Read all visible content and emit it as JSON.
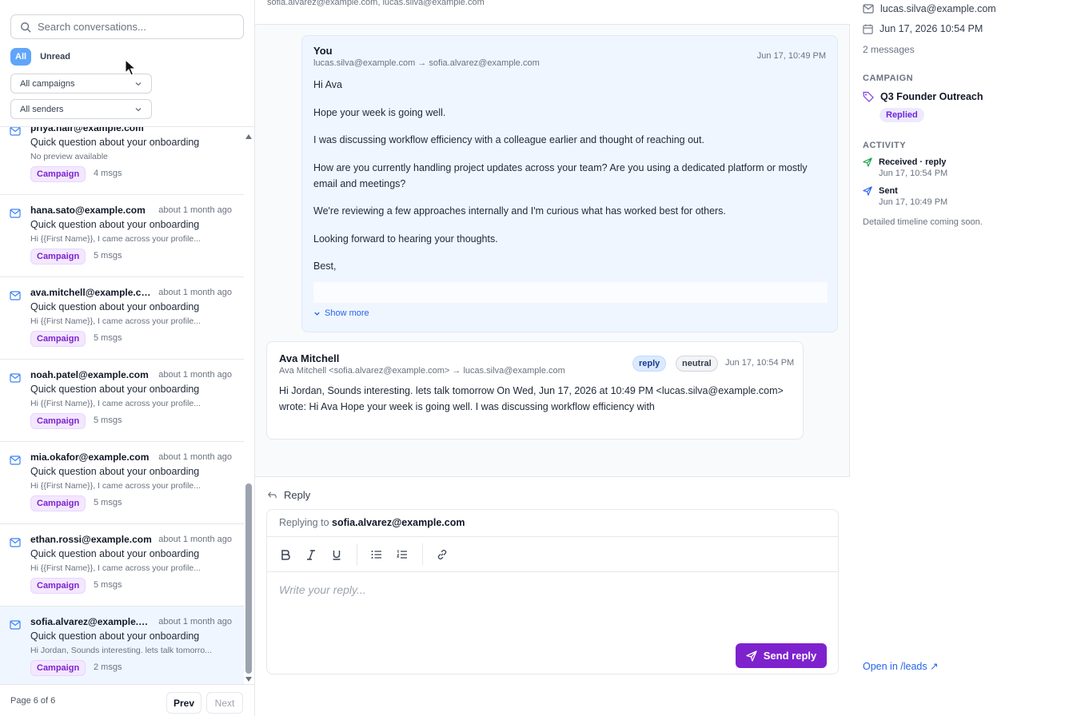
{
  "sidebar": {
    "search_placeholder": "Search conversations...",
    "filter_all": "All",
    "filter_unread": "Unread",
    "campaign_select": "All campaigns",
    "sender_select": "All senders",
    "items": [
      {
        "email": "priya.nair@example.com",
        "time": "",
        "subject": "Quick question about your onboarding",
        "preview": "No preview available",
        "badge": "Campaign",
        "msgs": "4 msgs"
      },
      {
        "email": "hana.sato@example.com",
        "time": "about 1 month ago",
        "subject": "Quick question about your onboarding",
        "preview": "Hi {{First Name}}, I came across your profile...",
        "badge": "Campaign",
        "msgs": "5 msgs"
      },
      {
        "email": "ava.mitchell@example.com",
        "time": "about 1 month ago",
        "subject": "Quick question about your onboarding",
        "preview": "Hi {{First Name}}, I came across your profile...",
        "badge": "Campaign",
        "msgs": "5 msgs"
      },
      {
        "email": "noah.patel@example.com",
        "time": "about 1 month ago",
        "subject": "Quick question about your onboarding",
        "preview": "Hi {{First Name}}, I came across your profile...",
        "badge": "Campaign",
        "msgs": "5 msgs"
      },
      {
        "email": "mia.okafor@example.com",
        "time": "about 1 month ago",
        "subject": "Quick question about your onboarding",
        "preview": "Hi {{First Name}}, I came across your profile...",
        "badge": "Campaign",
        "msgs": "5 msgs"
      },
      {
        "email": "ethan.rossi@example.com",
        "time": "about 1 month ago",
        "subject": "Quick question about your onboarding",
        "preview": "Hi {{First Name}}, I came across your profile...",
        "badge": "Campaign",
        "msgs": "5 msgs"
      },
      {
        "email": "sofia.alvarez@example.com",
        "time": "about 1 month ago",
        "subject": "Quick question about your onboarding",
        "preview": "Hi Jordan, Sounds interesting. lets talk tomorro...",
        "badge": "Campaign",
        "msgs": "2 msgs"
      }
    ],
    "pager": {
      "info": "Page 6 of 6",
      "prev": "Prev",
      "next": "Next"
    }
  },
  "thread": {
    "top_recipients": "sofia.alvarez@example.com, lucas.silva@example.com",
    "message1": {
      "from": "You",
      "route": "lucas.silva@example.com → sofia.alvarez@example.com",
      "time": "Jun 17, 10:49 PM",
      "paragraphs": [
        "Hi Ava",
        "Hope your week is going well.",
        "I was discussing workflow efficiency with a colleague earlier and thought of reaching out.",
        "How are you currently handling project updates across your team? Are you using a dedicated platform or mostly email and meetings?",
        "We're reviewing a few approaches internally and I'm curious what has worked best for others.",
        "Looking forward to hearing your thoughts.",
        "Best,"
      ],
      "show_more": "Show more"
    },
    "message2": {
      "from": "Ava Mitchell",
      "route": "Ava Mitchell <sofia.alvarez@example.com> → lucas.silva@example.com",
      "tag_reply": "reply",
      "tag_neutral": "neutral",
      "time": "Jun 17, 10:54 PM",
      "body": "Hi Jordan, Sounds interesting. lets talk tomorrow On Wed, Jun 17, 2026 at 10:49 PM <lucas.silva@example.com> wrote: Hi Ava Hope your week is going well. I was discussing workflow efficiency with"
    }
  },
  "reply": {
    "title": "Reply",
    "replying_to_label": "Replying to",
    "replying_to_email": "sofia.alvarez@example.com",
    "placeholder": "Write your reply...",
    "send_label": "Send reply"
  },
  "details": {
    "email": "lucas.silva@example.com",
    "date": "Jun 17, 2026 10:54 PM",
    "message_count": "2 messages",
    "campaign_label": "CAMPAIGN",
    "campaign_name": "Q3 Founder Outreach",
    "campaign_status": "Replied",
    "activity_label": "ACTIVITY",
    "activity": [
      {
        "title": "Received · reply",
        "time": "Jun 17, 10:54 PM"
      },
      {
        "title": "Sent",
        "time": "Jun 17, 10:49 PM"
      }
    ],
    "coming_soon": "Detailed timeline coming soon.",
    "open_leads": "Open in /leads ↗"
  },
  "colors": {
    "accent_blue": "#60a5fa",
    "purple": "#7e22ce",
    "link": "#2563eb"
  }
}
